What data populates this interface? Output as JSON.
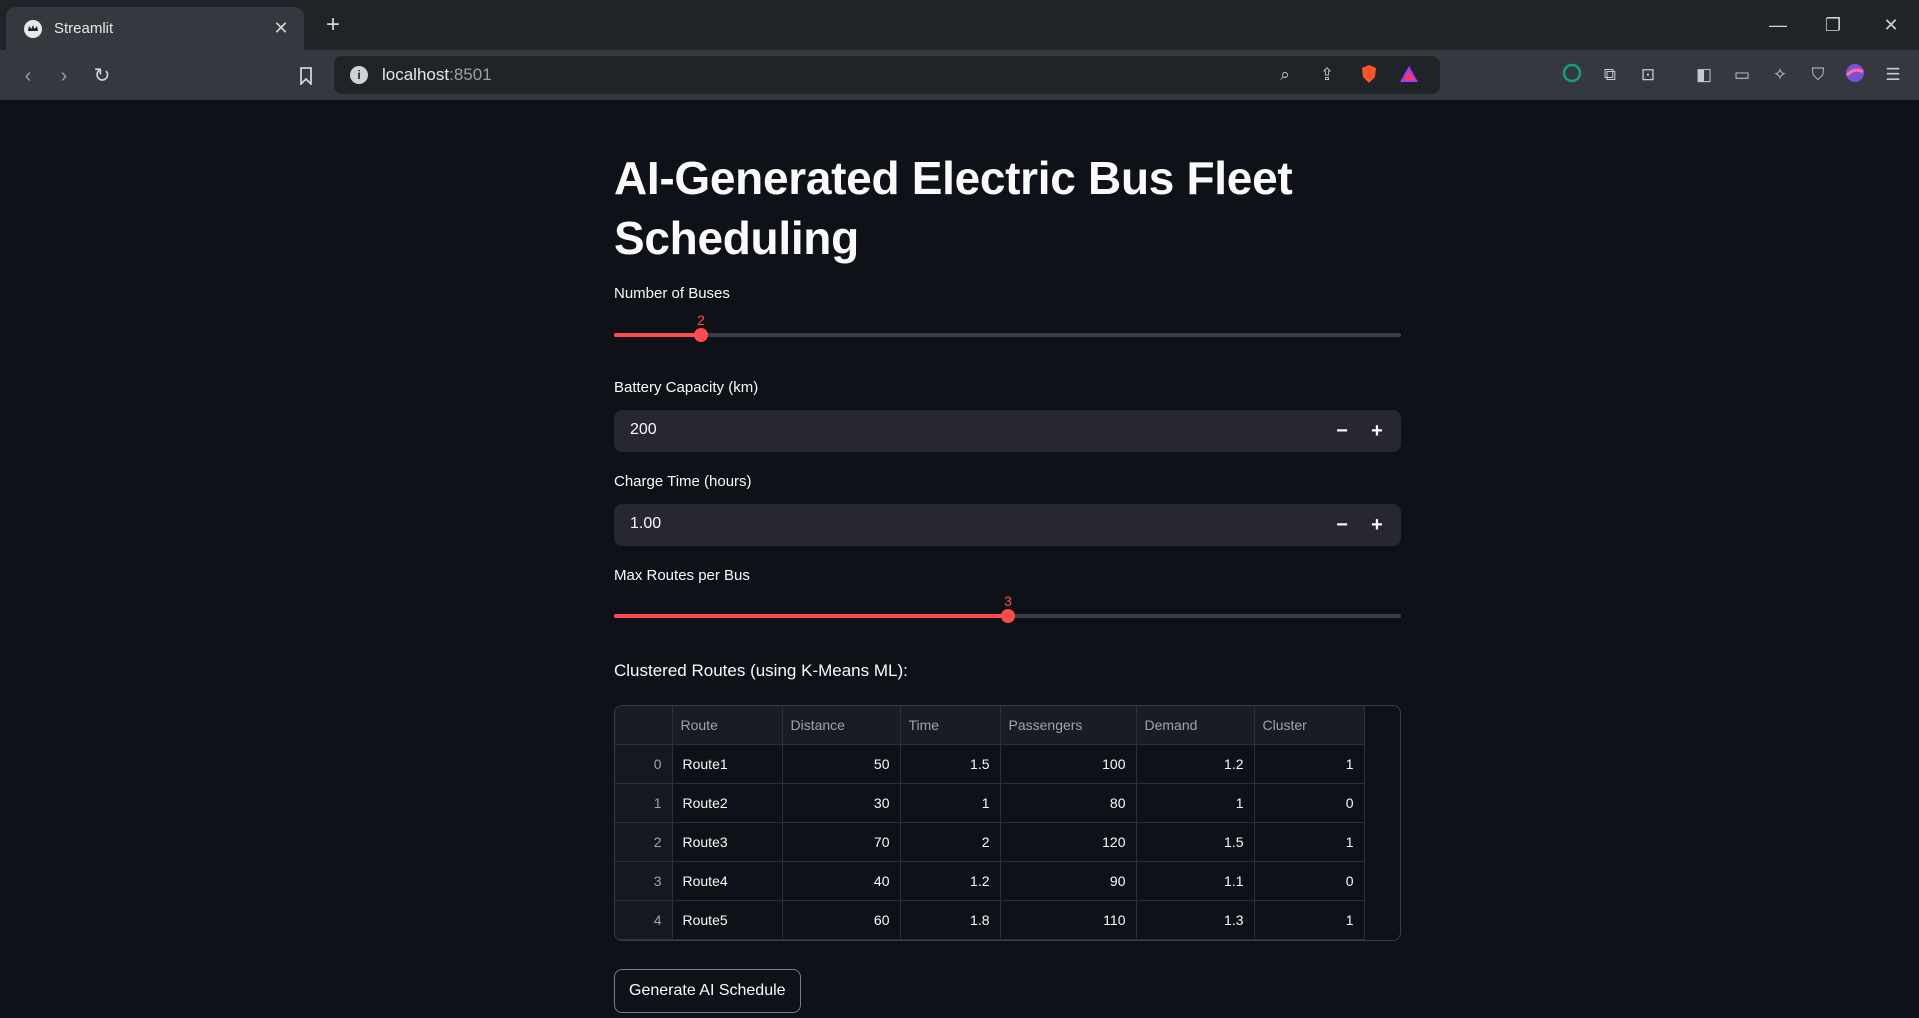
{
  "browser": {
    "tab_title": "Streamlit",
    "url_host": "localhost",
    "url_port": ":8501"
  },
  "app": {
    "title": "AI-Generated Electric Bus Fleet Scheduling",
    "num_buses": {
      "label": "Number of Buses",
      "value": "2",
      "min": 1,
      "max": 10
    },
    "battery": {
      "label": "Battery Capacity (km)",
      "value": "200"
    },
    "charge_time": {
      "label": "Charge Time (hours)",
      "value": "1.00"
    },
    "max_routes": {
      "label": "Max Routes per Bus",
      "value": "3",
      "min": 1,
      "max": 5
    },
    "table_heading": "Clustered Routes (using K-Means ML):",
    "table": {
      "columns": [
        "",
        "Route",
        "Distance",
        "Time",
        "Passengers",
        "Demand",
        "Cluster"
      ],
      "rows": [
        [
          "0",
          "Route1",
          "50",
          "1.5",
          "100",
          "1.2",
          "1"
        ],
        [
          "1",
          "Route2",
          "30",
          "1",
          "80",
          "1",
          "0"
        ],
        [
          "2",
          "Route3",
          "70",
          "2",
          "120",
          "1.5",
          "1"
        ],
        [
          "3",
          "Route4",
          "40",
          "1.2",
          "90",
          "1.1",
          "0"
        ],
        [
          "4",
          "Route5",
          "60",
          "1.8",
          "110",
          "1.3",
          "1"
        ]
      ]
    },
    "generate_button": "Generate AI Schedule"
  },
  "colors": {
    "accent": "#ff4b4b",
    "background": "#0e1117",
    "input_bg": "#262730"
  }
}
